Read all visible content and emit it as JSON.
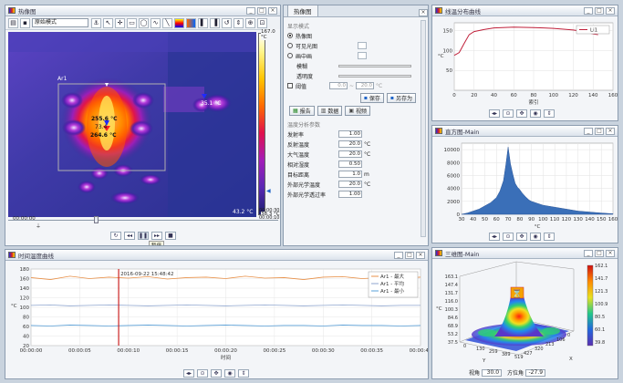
{
  "thermal_window": {
    "title": "热像图",
    "toolbar_mode": "原始模式",
    "area_label": "Ar1",
    "spot_labels": [
      "255.6 °C",
      "73.4",
      "264.6 °C",
      "35.1 °C"
    ],
    "scale_max": "167.0 °C",
    "scale_min": "38.3 °C",
    "bottom_right_temp": "43.2 °C",
    "time_start": "00:00:00",
    "time_end": "00:00:30",
    "time_sub": "00:00:10",
    "play_tooltip": "暂停",
    "colors": {
      "accent": "#1e63c8",
      "cursor": "#cc2222"
    }
  },
  "props_panel": {
    "tab": "热像图",
    "display_mode_label": "显示模式",
    "radio_thermal": "热像图",
    "radio_visible": "可见光图",
    "radio_fusion": "画中画",
    "opacity_label": "模糊",
    "transparency_label": "透明度",
    "threshold_label": "阈值",
    "threshold_from": "0.0",
    "threshold_to": "20.0",
    "save_btn": "保存",
    "save_as_btn": "另存为",
    "report_btn": "报告",
    "data_btn": "数据",
    "video_btn": "视频",
    "params_label": "温度分析参数",
    "params": [
      {
        "label": "发射率",
        "value": "1.00",
        "unit": ""
      },
      {
        "label": "反射温度",
        "value": "20.0",
        "unit": "°C"
      },
      {
        "label": "大气温度",
        "value": "20.0",
        "unit": "°C"
      },
      {
        "label": "相对湿度",
        "value": "0.50",
        "unit": ""
      },
      {
        "label": "目标距离",
        "value": "1.0",
        "unit": "m"
      },
      {
        "label": "外部光学温度",
        "value": "20.0",
        "unit": "°C"
      },
      {
        "label": "外部光学透过率",
        "value": "1.00",
        "unit": ""
      }
    ]
  },
  "profile_window": {
    "title": "线温分布曲线",
    "legend": "Li1",
    "xlabel": "索引",
    "ylabel": "°C",
    "x_ticks": [
      "0",
      "20",
      "40",
      "60",
      "80",
      "100",
      "120",
      "140",
      "160"
    ],
    "y_ticks": [
      "150",
      "100",
      "50"
    ],
    "chart_data": {
      "type": "line",
      "x": [
        0,
        5,
        10,
        15,
        20,
        30,
        40,
        60,
        80,
        90,
        100,
        120,
        130,
        140,
        145
      ],
      "values": [
        88,
        95,
        118,
        140,
        148,
        153,
        157,
        159,
        158,
        157,
        156,
        152,
        148,
        142,
        140
      ],
      "xlim": [
        0,
        160
      ],
      "ylim": [
        0,
        170
      ]
    }
  },
  "histogram_window": {
    "title": "直方图-Main",
    "xlabel": "°C",
    "x_ticks": [
      "30",
      "40",
      "50",
      "60",
      "70",
      "80",
      "90",
      "100",
      "110",
      "120",
      "130",
      "140",
      "150",
      "160"
    ],
    "y_ticks": [
      "10000",
      "8000",
      "6000",
      "4000",
      "2000",
      "0"
    ],
    "chart_data": {
      "type": "area",
      "x": [
        30,
        35,
        40,
        45,
        50,
        55,
        60,
        63,
        66,
        68,
        70,
        72,
        74,
        76,
        78,
        80,
        82,
        85,
        88,
        90,
        95,
        100,
        110,
        120,
        130,
        140,
        150,
        160
      ],
      "values": [
        0,
        200,
        500,
        800,
        1300,
        1800,
        2600,
        3600,
        5200,
        7600,
        10400,
        7800,
        6200,
        4800,
        4200,
        3800,
        3300,
        2700,
        2200,
        2000,
        1700,
        1400,
        1100,
        800,
        500,
        350,
        200,
        80
      ],
      "xlim": [
        30,
        160
      ],
      "ylim": [
        0,
        11000
      ]
    }
  },
  "timeline_window": {
    "title": "时间温度曲线",
    "timestamp": "2016-09-22 15:48:42",
    "ylabel": "°C",
    "xlabel": "时间",
    "legend": [
      "Ar1 - 最大",
      "Ar1 - 平均",
      "Ar1 - 最小"
    ],
    "y_ticks": [
      "180",
      "160",
      "140",
      "120",
      "100",
      "80",
      "60",
      "40",
      "20"
    ],
    "x_ticks": [
      "00:00:00",
      "00:00:05",
      "00:00:10",
      "00:00:15",
      "00:00:20",
      "00:00:25",
      "00:00:30",
      "00:00:35",
      "00:00:40"
    ],
    "chart_data": {
      "type": "line",
      "x_unit": "seconds",
      "series": [
        {
          "name": "Ar1 - 最大",
          "values": [
            162,
            158,
            165,
            160,
            163,
            161,
            164,
            159,
            162,
            163,
            160,
            165,
            161,
            162,
            158,
            163,
            164,
            160,
            162,
            161,
            163
          ]
        },
        {
          "name": "Ar1 - 平均",
          "values": [
            104,
            105,
            103,
            104,
            105,
            104,
            103,
            104,
            105,
            104,
            103,
            104,
            105,
            104,
            103,
            104,
            105,
            104,
            103,
            104,
            104
          ]
        },
        {
          "name": "Ar1 - 最小",
          "values": [
            62,
            61,
            63,
            62,
            61,
            62,
            63,
            62,
            61,
            62,
            63,
            62,
            61,
            62,
            62,
            61,
            63,
            62,
            62,
            61,
            62
          ]
        }
      ],
      "cursor_x": 9,
      "xlim": [
        0,
        40
      ],
      "ylim": [
        20,
        180
      ]
    }
  },
  "view3d_window": {
    "title": "三维图-Main",
    "ylabel": "°C",
    "angle_label": "视角",
    "angle_value": "30.0",
    "azimuth_label": "方位角",
    "azimuth_value": "-27.9",
    "z_ticks": [
      "163.1",
      "147.4",
      "131.7",
      "116.0",
      "100.3",
      "84.6",
      "68.9",
      "53.2",
      "37.5"
    ],
    "colorbar_ticks": [
      "162.1",
      "141.7",
      "121.3",
      "100.9",
      "80.5",
      "60.1",
      "39.8"
    ],
    "axis_x": "X",
    "axis_y": "Y",
    "x_ticks": [
      "427",
      "320",
      "213",
      "106",
      "0"
    ],
    "y_ticks": [
      "0",
      "130",
      "259",
      "389",
      "519"
    ]
  }
}
